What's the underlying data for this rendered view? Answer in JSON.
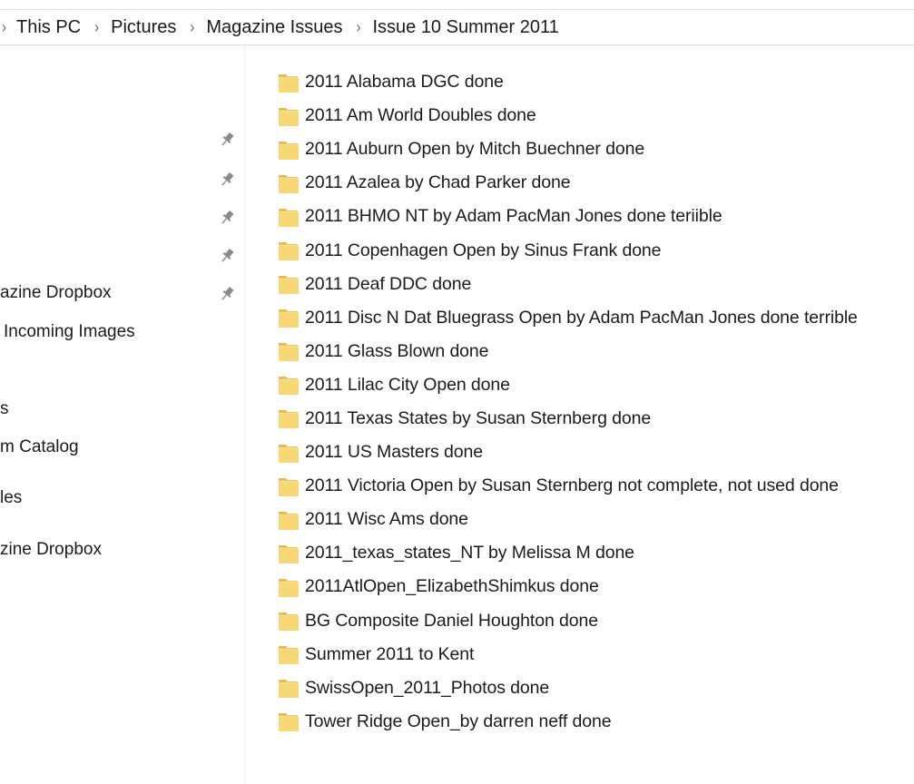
{
  "breadcrumb": {
    "items": [
      "This PC",
      "Pictures",
      "Magazine Issues",
      "Issue 10 Summer 2011"
    ],
    "separator": "›"
  },
  "nav_pane": {
    "items": [
      {
        "label": "azine Dropbox",
        "pinned": true
      },
      {
        "label": "Incoming Images",
        "pinned": false
      },
      {
        "label": "s",
        "pinned": false
      },
      {
        "label": "m Catalog",
        "pinned": false
      },
      {
        "label": "les",
        "pinned": false
      },
      {
        "label": "zine Dropbox",
        "pinned": false
      }
    ],
    "pin_icon_count": 5
  },
  "files": {
    "items": [
      {
        "name": "2011 Alabama DGC done",
        "type": "folder"
      },
      {
        "name": "2011 Am World Doubles done",
        "type": "folder"
      },
      {
        "name": "2011 Auburn Open by Mitch Buechner done",
        "type": "folder"
      },
      {
        "name": "2011 Azalea by Chad Parker done",
        "type": "folder"
      },
      {
        "name": "2011 BHMO NT by Adam PacMan Jones done teriible",
        "type": "folder"
      },
      {
        "name": "2011 Copenhagen Open by Sinus Frank done",
        "type": "folder"
      },
      {
        "name": "2011 Deaf DDC done",
        "type": "folder"
      },
      {
        "name": "2011 Disc N Dat Bluegrass Open by Adam PacMan Jones done terrible",
        "type": "folder"
      },
      {
        "name": "2011 Glass Blown done",
        "type": "folder"
      },
      {
        "name": "2011 Lilac City Open done",
        "type": "folder"
      },
      {
        "name": "2011 Texas States by Susan Sternberg done",
        "type": "folder"
      },
      {
        "name": "2011 US Masters done",
        "type": "folder"
      },
      {
        "name": "2011 Victoria Open by Susan Sternberg not complete, not used done",
        "type": "folder"
      },
      {
        "name": "2011 Wisc Ams done",
        "type": "folder"
      },
      {
        "name": "2011_texas_states_NT by Melissa M done",
        "type": "folder"
      },
      {
        "name": "2011AtlOpen_ElizabethShimkus done",
        "type": "folder"
      },
      {
        "name": "BG Composite Daniel Houghton done",
        "type": "folder"
      },
      {
        "name": "Summer 2011 to Kent",
        "type": "folder"
      },
      {
        "name": "SwissOpen_2011_Photos done",
        "type": "folder"
      },
      {
        "name": "Tower Ridge Open_by darren neff  done",
        "type": "folder"
      }
    ]
  },
  "colors": {
    "folder_body": "#f8d775",
    "folder_back": "#e6b94a",
    "pin": "#8a8a8a",
    "separator": "#6a6a6a"
  }
}
